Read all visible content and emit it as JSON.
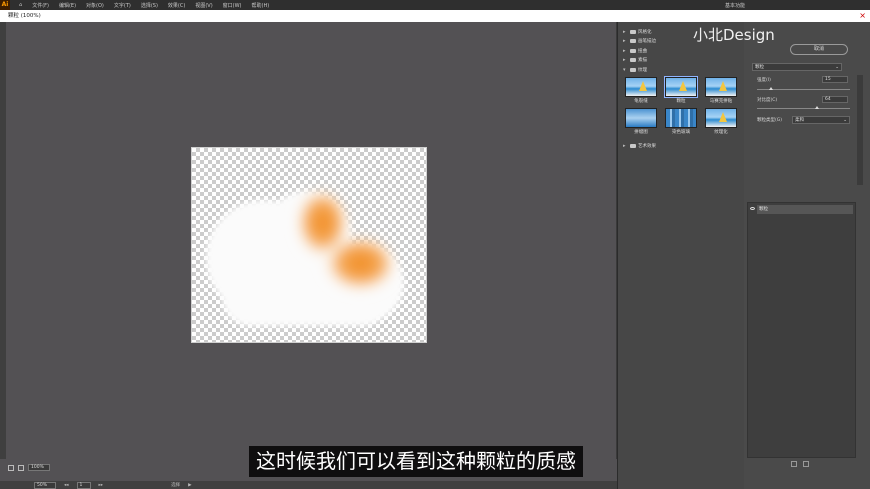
{
  "menubar": {
    "logo": "Ai",
    "items": [
      "文件(F)",
      "编辑(E)",
      "对象(O)",
      "文字(T)",
      "选择(S)",
      "效果(C)",
      "视图(V)",
      "窗口(W)",
      "帮助(H)"
    ],
    "workspace": "基本功能"
  },
  "document": {
    "tab_title": "颗粒 (100%)"
  },
  "status": {
    "zoom": "100%",
    "bottom_zoom": "50%",
    "page": "1",
    "tool": "选择"
  },
  "filter_gallery": {
    "categories": [
      {
        "label": "风格化",
        "expanded": false
      },
      {
        "label": "画笔描边",
        "expanded": false
      },
      {
        "label": "扭曲",
        "expanded": false
      },
      {
        "label": "素描",
        "expanded": false
      },
      {
        "label": "纹理",
        "expanded": true
      },
      {
        "label": "艺术效果",
        "expanded": false
      }
    ],
    "thumbnails": [
      "龟裂缝",
      "颗粒",
      "马赛克拼贴",
      "拼缀图",
      "染色玻璃",
      "纹理化"
    ],
    "selected": "颗粒"
  },
  "settings": {
    "ok_label": "取消",
    "filter_name": "颗粒",
    "intensity_label": "强度(I)",
    "intensity_value": "15",
    "intensity_fraction": 0.15,
    "contrast_label": "对比度(C)",
    "contrast_value": "64",
    "contrast_fraction": 0.64,
    "grain_type_label": "颗粒类型(G)",
    "grain_type_value": "柔和"
  },
  "layers": {
    "item": "颗粒"
  },
  "watermark": "小北Design",
  "subtitle": "这时候我们可以看到这种颗粒的质感",
  "colors": {
    "workspace_bg": "#535154",
    "orange": "#f08a1e",
    "panel_bg": "#474747"
  }
}
